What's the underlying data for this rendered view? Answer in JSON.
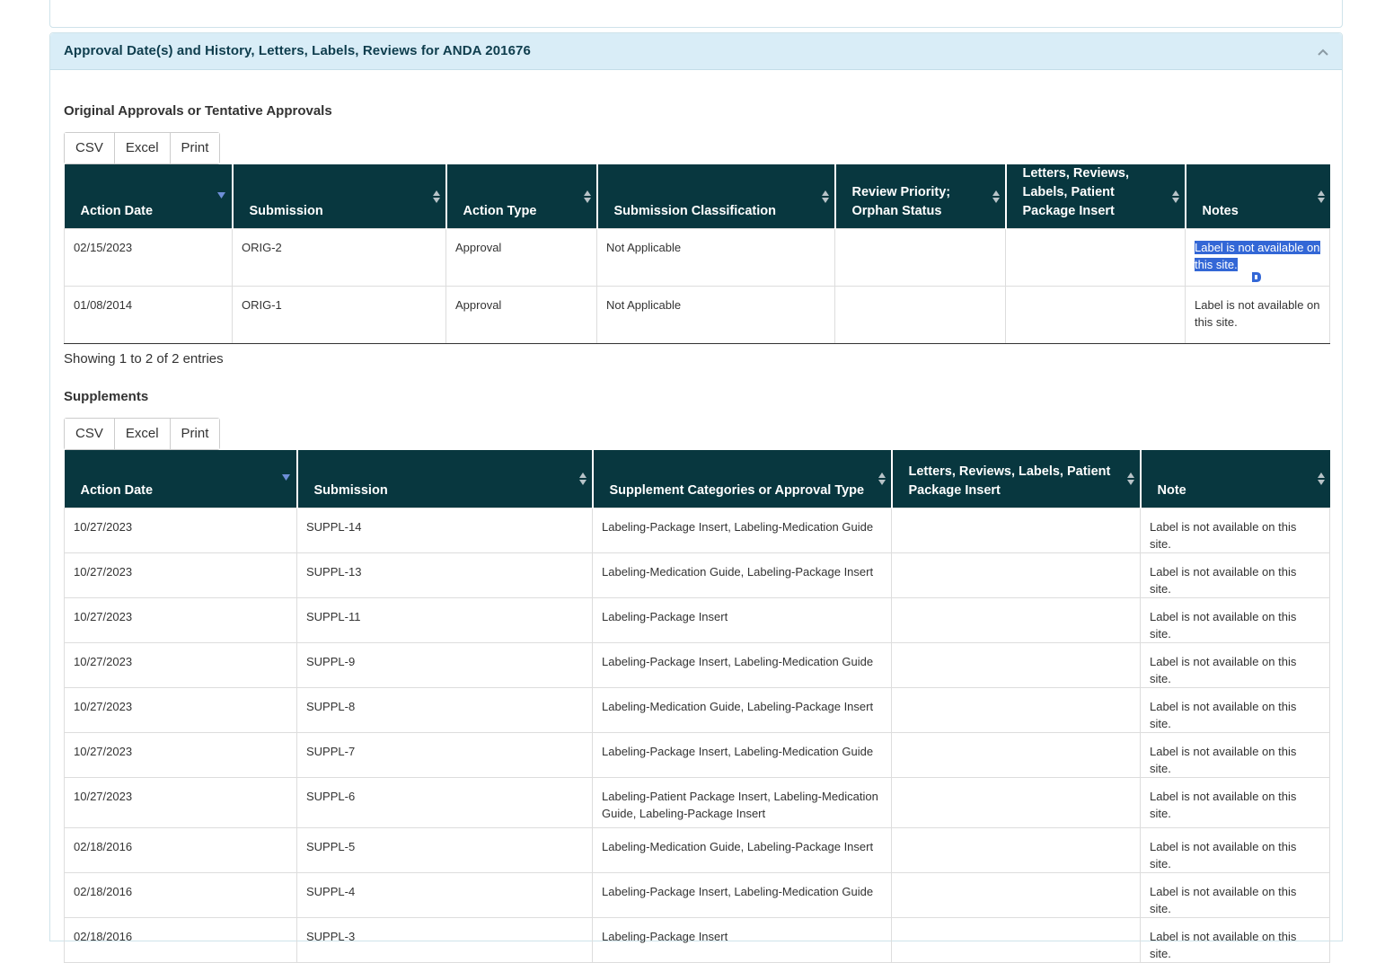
{
  "panel": {
    "title": "Approval Date(s) and History, Letters, Labels, Reviews for ANDA 201676"
  },
  "original": {
    "title": "Original Approvals or Tentative Approvals",
    "buttons": [
      "CSV",
      "Excel",
      "Print"
    ],
    "columns": [
      "Action Date",
      "Submission",
      "Action Type",
      "Submission Classification",
      "Review Priority; Orphan Status",
      "Letters, Reviews, Labels, Patient Package Insert",
      "Notes"
    ],
    "rows": [
      {
        "date": "02/15/2023",
        "submission": "ORIG-2",
        "action": "Approval",
        "classification": "Not Applicable",
        "priority": "",
        "letters": "",
        "notes": "Label is not available on this site."
      },
      {
        "date": "01/08/2014",
        "submission": "ORIG-1",
        "action": "Approval",
        "classification": "Not Applicable",
        "priority": "",
        "letters": "",
        "notes": "Label is not available on this site."
      }
    ],
    "info": "Showing 1 to 2 of 2 entries"
  },
  "supplements": {
    "title": "Supplements",
    "buttons": [
      "CSV",
      "Excel",
      "Print"
    ],
    "columns": [
      "Action Date",
      "Submission",
      "Supplement Categories or Approval Type",
      "Letters, Reviews, Labels, Patient Package Insert",
      "Note"
    ],
    "rows": [
      {
        "date": "10/27/2023",
        "submission": "SUPPL-14",
        "category": "Labeling-Package Insert, Labeling-Medication Guide",
        "letters": "",
        "note": "Label is not available on this site."
      },
      {
        "date": "10/27/2023",
        "submission": "SUPPL-13",
        "category": "Labeling-Medication Guide, Labeling-Package Insert",
        "letters": "",
        "note": "Label is not available on this site."
      },
      {
        "date": "10/27/2023",
        "submission": "SUPPL-11",
        "category": "Labeling-Package Insert",
        "letters": "",
        "note": "Label is not available on this site."
      },
      {
        "date": "10/27/2023",
        "submission": "SUPPL-9",
        "category": "Labeling-Package Insert, Labeling-Medication Guide",
        "letters": "",
        "note": "Label is not available on this site."
      },
      {
        "date": "10/27/2023",
        "submission": "SUPPL-8",
        "category": "Labeling-Medication Guide, Labeling-Package Insert",
        "letters": "",
        "note": "Label is not available on this site."
      },
      {
        "date": "10/27/2023",
        "submission": "SUPPL-7",
        "category": "Labeling-Package Insert, Labeling-Medication Guide",
        "letters": "",
        "note": "Label is not available on this site."
      },
      {
        "date": "10/27/2023",
        "submission": "SUPPL-6",
        "category": "Labeling-Patient Package Insert, Labeling-Medication Guide, Labeling-Package Insert",
        "letters": "",
        "note": "Label is not available on this site."
      },
      {
        "date": "02/18/2016",
        "submission": "SUPPL-5",
        "category": "Labeling-Medication Guide, Labeling-Package Insert",
        "letters": "",
        "note": "Label is not available on this site."
      },
      {
        "date": "02/18/2016",
        "submission": "SUPPL-4",
        "category": "Labeling-Package Insert, Labeling-Medication Guide",
        "letters": "",
        "note": "Label is not available on this site."
      },
      {
        "date": "02/18/2016",
        "submission": "SUPPL-3",
        "category": "Labeling-Package Insert",
        "letters": "",
        "note": "Label is not available on this site."
      }
    ]
  },
  "icons": {
    "collapse": "chevron-up-icon",
    "sort": "sort-both-icon",
    "sort_desc": "sort-desc-icon"
  },
  "colors": {
    "header_bg": "#08373f",
    "panel_head_bg": "#d9edf7",
    "selection": "#3367d6",
    "sort_active": "#6e8fd8"
  }
}
